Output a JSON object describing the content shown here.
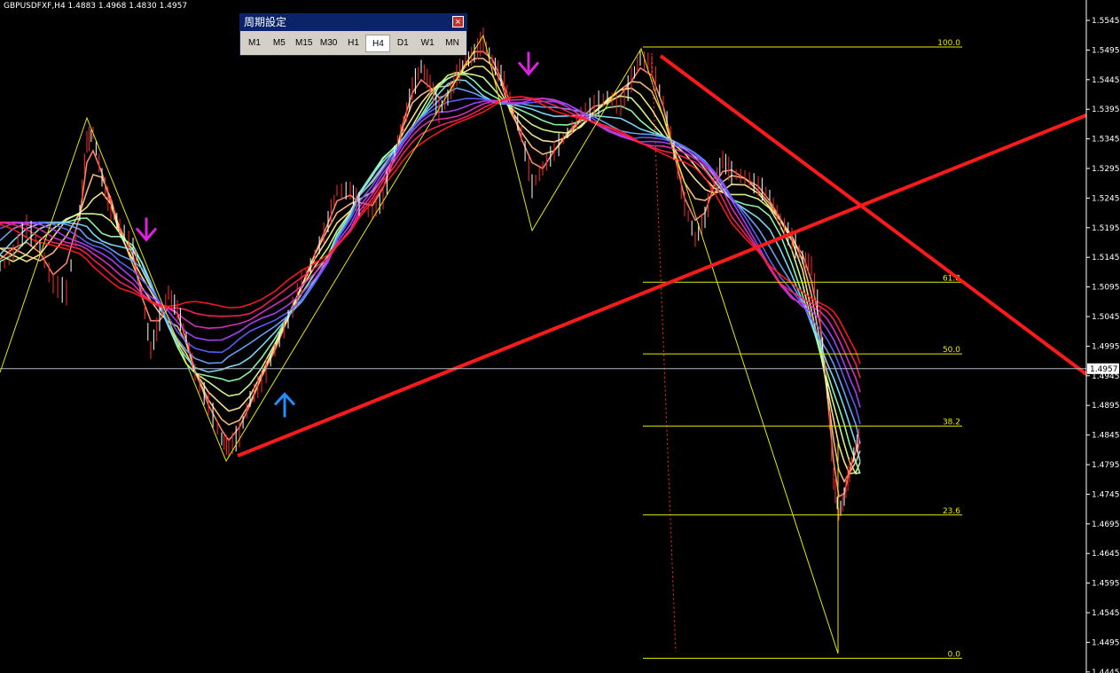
{
  "symbol_info": "GBPUSDFXF,H4  1.4883 1.4968 1.4830 1.4957",
  "period_panel": {
    "title": "周期設定",
    "close_icon": "×",
    "buttons": [
      "M1",
      "M5",
      "M15",
      "M30",
      "H1",
      "H4",
      "D1",
      "W1",
      "MN"
    ],
    "active": "H4"
  },
  "colors": {
    "background": "#000000",
    "trendline": "#ff1a1a",
    "fibonacci": "#e8e800",
    "arrow_down": "#e020e0",
    "arrow_up": "#1e90ff"
  },
  "chart_data": {
    "type": "line",
    "price_axis": {
      "min": 1.4445,
      "max": 1.5545,
      "ticks": [
        "1.5545",
        "1.5495",
        "1.5445",
        "1.5395",
        "1.5345",
        "1.5295",
        "1.5245",
        "1.5195",
        "1.5145",
        "1.5095",
        "1.5045",
        "1.4995",
        "1.4945",
        "1.4895",
        "1.4845",
        "1.4795",
        "1.4745",
        "1.4695",
        "1.4645",
        "1.4595",
        "1.4545",
        "1.4495",
        "1.4445"
      ]
    },
    "current_price": "1.4957",
    "fibonacci_levels": [
      {
        "label": "100.0",
        "price": 1.55
      },
      {
        "label": "61.8",
        "price": 1.5103
      },
      {
        "label": "50.0",
        "price": 1.4982
      },
      {
        "label": "38.2",
        "price": 1.486
      },
      {
        "label": "23.6",
        "price": 1.471
      },
      {
        "label": "0.0",
        "price": 1.4468
      }
    ],
    "signals": [
      {
        "type": "sell-arrow",
        "price": 1.5185
      },
      {
        "type": "sell-arrow",
        "price": 1.5465
      },
      {
        "type": "buy-arrow",
        "price": 1.4905
      }
    ]
  }
}
